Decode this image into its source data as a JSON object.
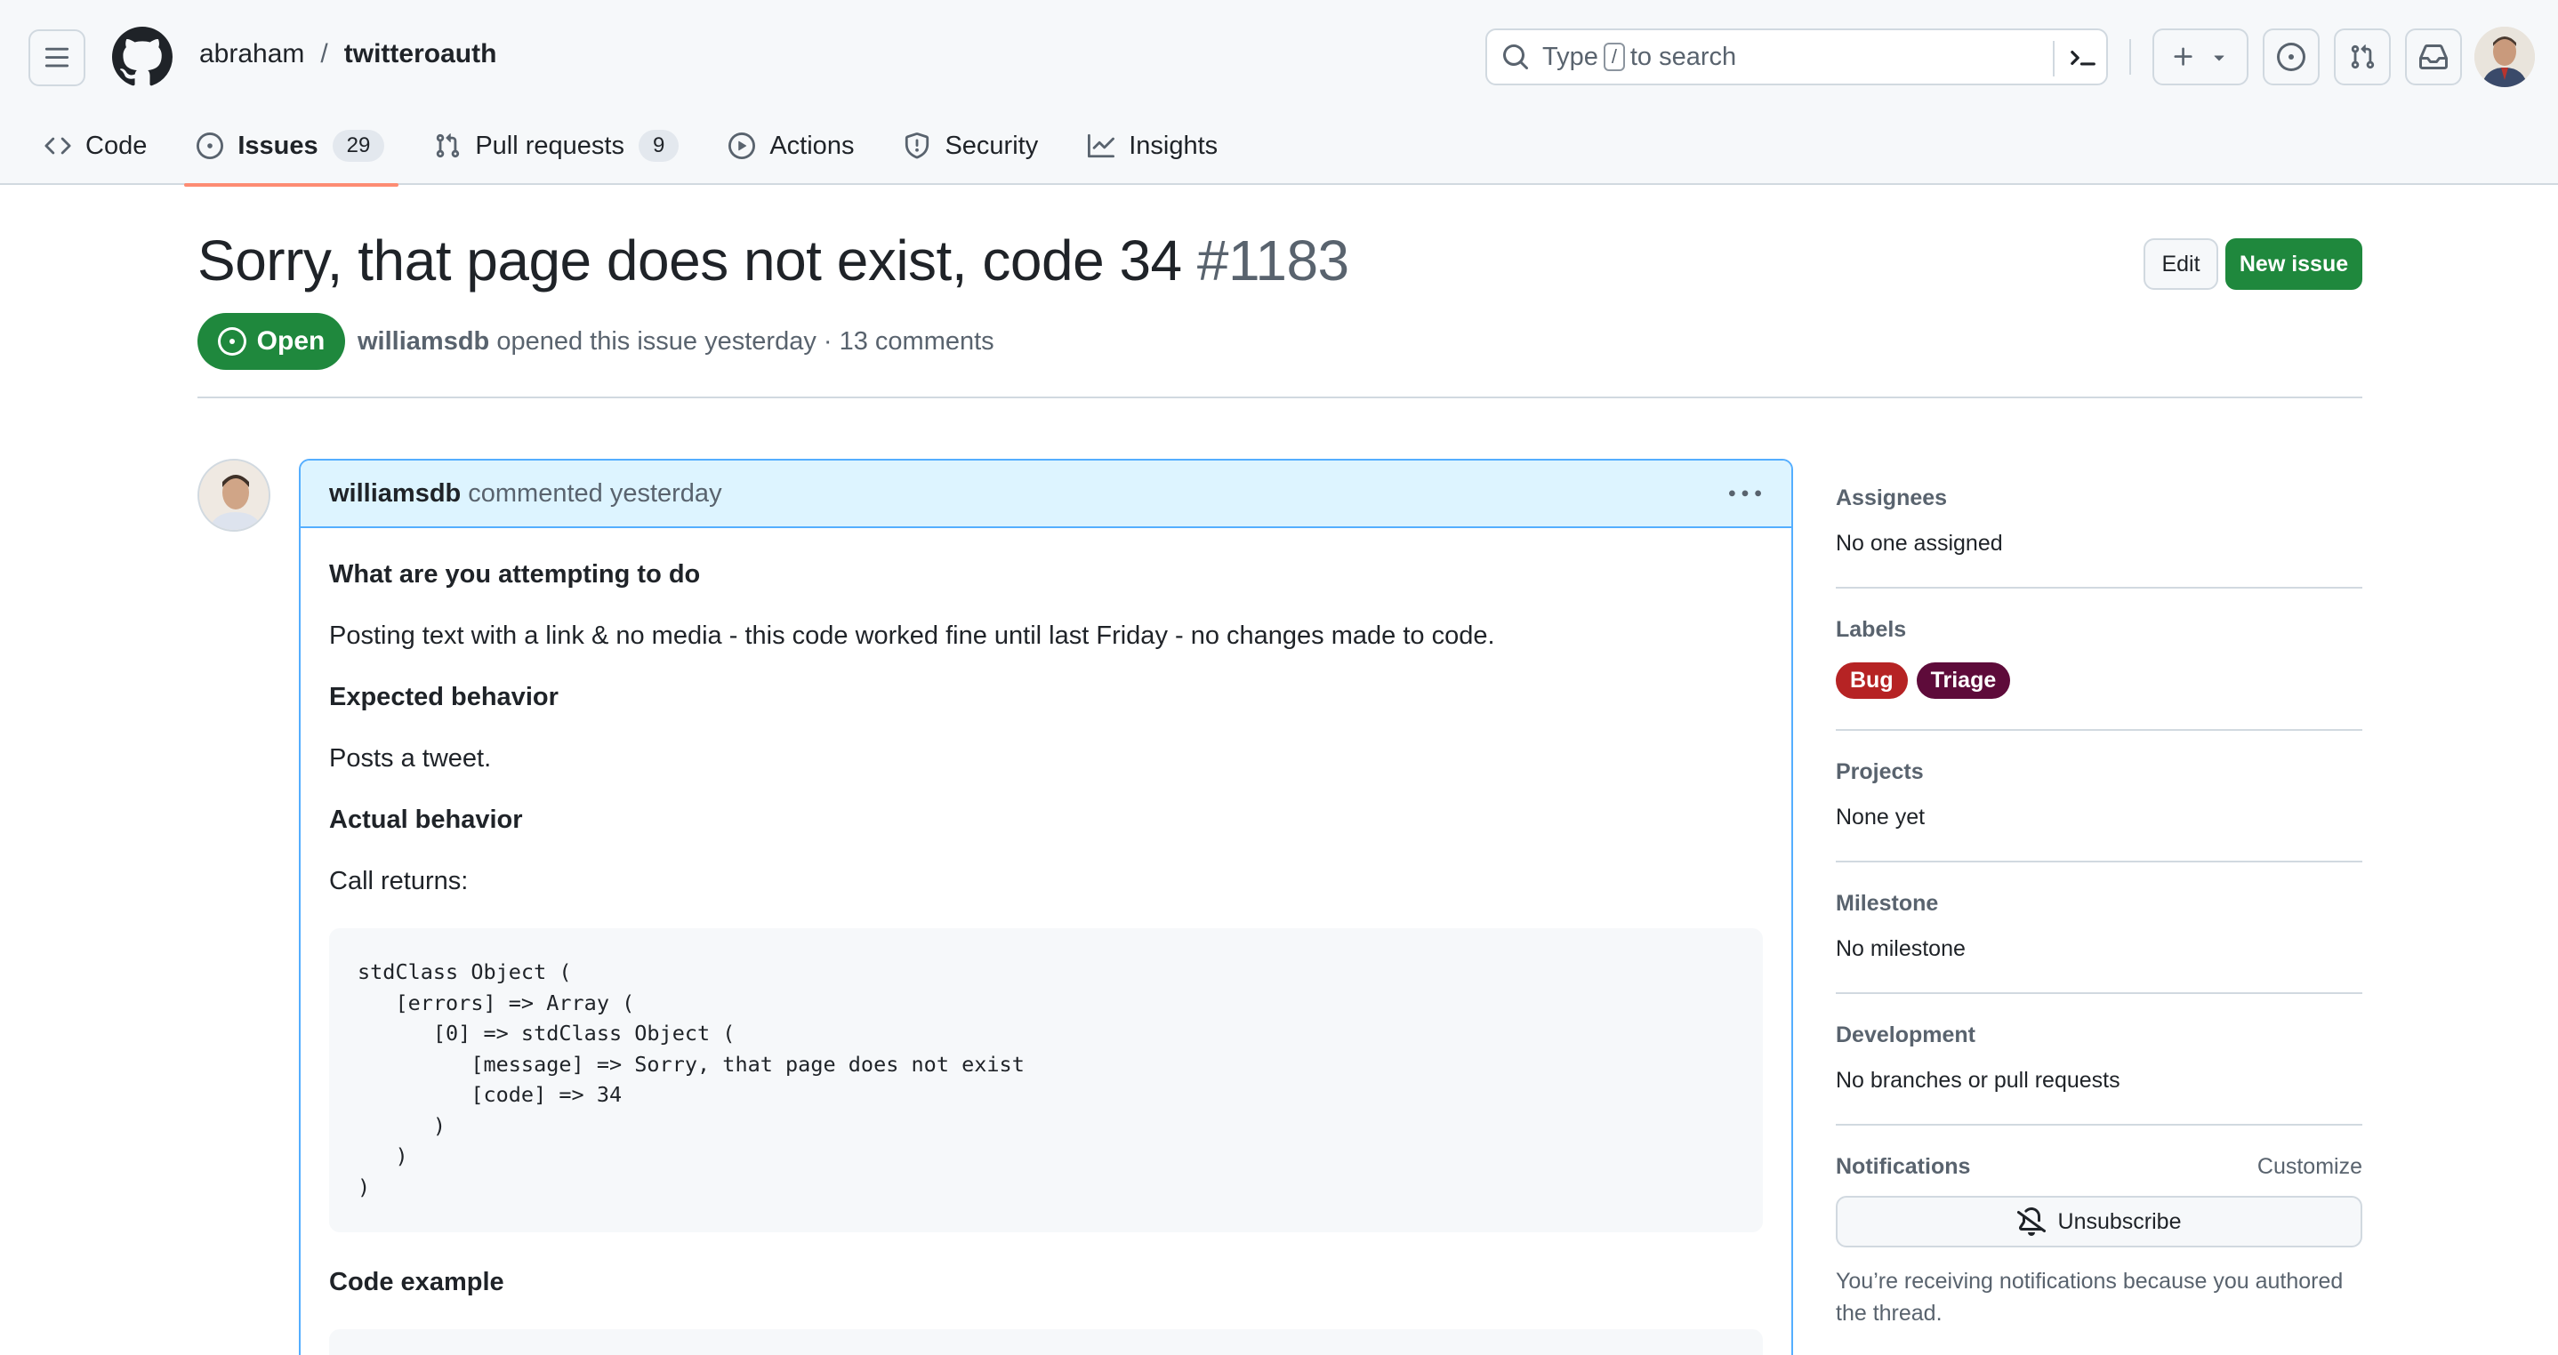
{
  "header": {
    "owner": "abraham",
    "separator": "/",
    "repo": "twitteroauth",
    "search_prefix": "Type",
    "search_key": "/",
    "search_suffix": "to search"
  },
  "tabs": [
    {
      "label": "Code",
      "icon": "code-icon"
    },
    {
      "label": "Issues",
      "count": "29",
      "icon": "issue-opened-icon"
    },
    {
      "label": "Pull requests",
      "count": "9",
      "icon": "git-pull-request-icon"
    },
    {
      "label": "Actions",
      "icon": "play-icon"
    },
    {
      "label": "Security",
      "icon": "shield-icon"
    },
    {
      "label": "Insights",
      "icon": "graph-icon"
    }
  ],
  "issue": {
    "title": "Sorry, that page does not exist, code 34",
    "number": "#1183",
    "state": "Open",
    "author": "williamsdb",
    "opened_text": "opened this issue yesterday · 13 comments",
    "edit_label": "Edit",
    "new_issue_label": "New issue"
  },
  "comment": {
    "author": "williamsdb",
    "action": "commented yesterday",
    "h_attempt": "What are you attempting to do",
    "p_attempt": "Posting text with a link & no media - this code worked fine until last Friday - no changes made to code.",
    "h_expected": "Expected behavior",
    "p_expected": "Posts a tweet.",
    "h_actual": "Actual behavior",
    "p_actual": "Call returns:",
    "code": "stdClass Object (\n   [errors] => Array (\n      [0] => stdClass Object (\n         [message] => Sorry, that page does not exist\n         [code] => 34\n      )\n   )\n)",
    "h_code_example": "Code example"
  },
  "sidebar": {
    "assignees_title": "Assignees",
    "assignees_value": "No one assigned",
    "labels_title": "Labels",
    "labels": [
      {
        "name": "Bug",
        "color": "#b62324"
      },
      {
        "name": "Triage",
        "color": "#5e0b3a"
      }
    ],
    "projects_title": "Projects",
    "projects_value": "None yet",
    "milestone_title": "Milestone",
    "milestone_value": "No milestone",
    "development_title": "Development",
    "development_value": "No branches or pull requests",
    "notifications_title": "Notifications",
    "customize_label": "Customize",
    "unsubscribe_label": "Unsubscribe",
    "notifications_note": "You’re receiving notifications because you authored the thread."
  }
}
